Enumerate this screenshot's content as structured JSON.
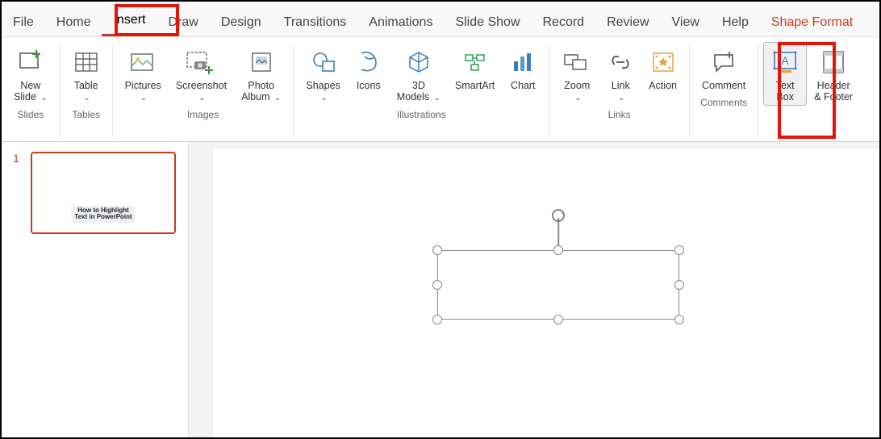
{
  "menu": {
    "file": "File",
    "home": "Home",
    "insert": "Insert",
    "draw": "Draw",
    "design": "Design",
    "transitions": "Transitions",
    "animations": "Animations",
    "slideshow": "Slide Show",
    "record": "Record",
    "review": "Review",
    "view": "View",
    "help": "Help",
    "shape_format": "Shape Format"
  },
  "ribbon": {
    "new_slide": "New\nSlide",
    "table": "Table",
    "pictures": "Pictures",
    "screenshot": "Screenshot",
    "photo_album": "Photo\nAlbum",
    "shapes": "Shapes",
    "icons": "Icons",
    "threed_models": "3D\nModels",
    "smartart": "SmartArt",
    "chart": "Chart",
    "zoom": "Zoom",
    "link": "Link",
    "action": "Action",
    "comment": "Comment",
    "text_box": "Text\nBox",
    "header_footer": "Header\n& Footer"
  },
  "groups": {
    "slides": "Slides",
    "tables": "Tables",
    "images": "Images",
    "illustrations": "Illustrations",
    "links": "Links",
    "comments": "Comments"
  },
  "thumb": {
    "number": "1",
    "text": "How to Highlight\nText in PowerPoint"
  },
  "chev": "⌄"
}
